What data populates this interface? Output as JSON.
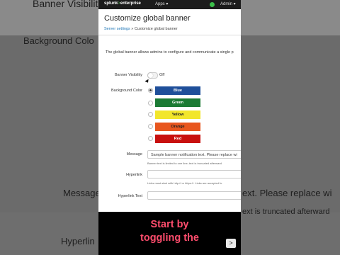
{
  "background": {
    "text1": "Banner Visibilit",
    "text2": "Background Colo",
    "text3": "Message",
    "text4": "ext. Please replace wi",
    "text5": "ext is truncated afterward",
    "text6": "Hyperlin"
  },
  "topbar": {
    "logo_main": "splunk",
    "logo_sep": ">",
    "logo_product": "enterprise",
    "apps_label": "Apps ▾",
    "admin_label": "Admin ▾",
    "status_color": "#3bbf4a"
  },
  "page": {
    "title": "Customize global banner",
    "breadcrumb_link": "Server settings",
    "breadcrumb_sep": " » ",
    "breadcrumb_current": "Customize global banner",
    "description": "The global banner allows admins to configure and communicate a single p"
  },
  "form": {
    "visibility_label": "Banner Visibility",
    "visibility_state": "Off",
    "background_label": "Background Color",
    "colors": [
      {
        "label": "Blue",
        "bg": "#1f4f9a",
        "fg": "#ffffff"
      },
      {
        "label": "Green",
        "bg": "#1b7a34",
        "fg": "#ffffff"
      },
      {
        "label": "Yellow",
        "bg": "#f2e62b",
        "fg": "#222222"
      },
      {
        "label": "Orange",
        "bg": "#e8561e",
        "fg": "#222222"
      },
      {
        "label": "Red",
        "bg": "#c8100e",
        "fg": "#ffffff"
      }
    ],
    "message_label": "Message",
    "message_value": "Sample banner notification text. Please replace wi",
    "message_help": "Banner text is limited to one line; text is truncated afterward",
    "hyperlink_label": "Hyperlink",
    "hyperlink_value": "",
    "hyperlink_help": "Links must start with http:// or https://. Links are accepted fo",
    "hyperlink_text_label": "Hyperlink Text",
    "hyperlink_text_value": ""
  },
  "overlay": {
    "caption_line1": "Start by",
    "caption_line2": "toggling the",
    "next_glyph": ">"
  }
}
